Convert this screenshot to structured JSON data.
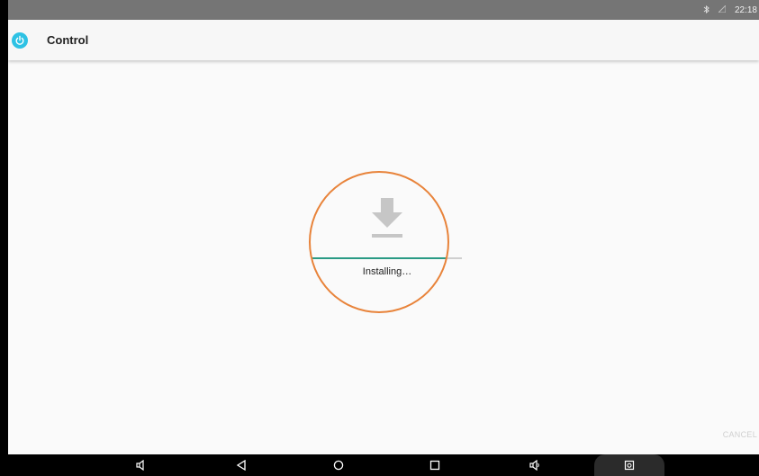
{
  "status_bar": {
    "bluetooth_icon": "bluetooth-icon",
    "signal_icon": "signal-icon",
    "clock": "22:18"
  },
  "app_bar": {
    "icon": "power-icon",
    "title": "Control"
  },
  "install": {
    "icon": "download-icon",
    "status": "Installing…",
    "progress": 0.89
  },
  "footer": {
    "cancel_label": "CANCEL"
  },
  "nav_bar": {
    "buttons": [
      "volume-down-icon",
      "back-icon",
      "home-icon",
      "recents-icon",
      "volume-up-icon",
      "screenshot-icon"
    ]
  },
  "colors": {
    "accent": "#2ec2e4",
    "progress": "#2a9a85",
    "highlight": "#e8833a"
  }
}
